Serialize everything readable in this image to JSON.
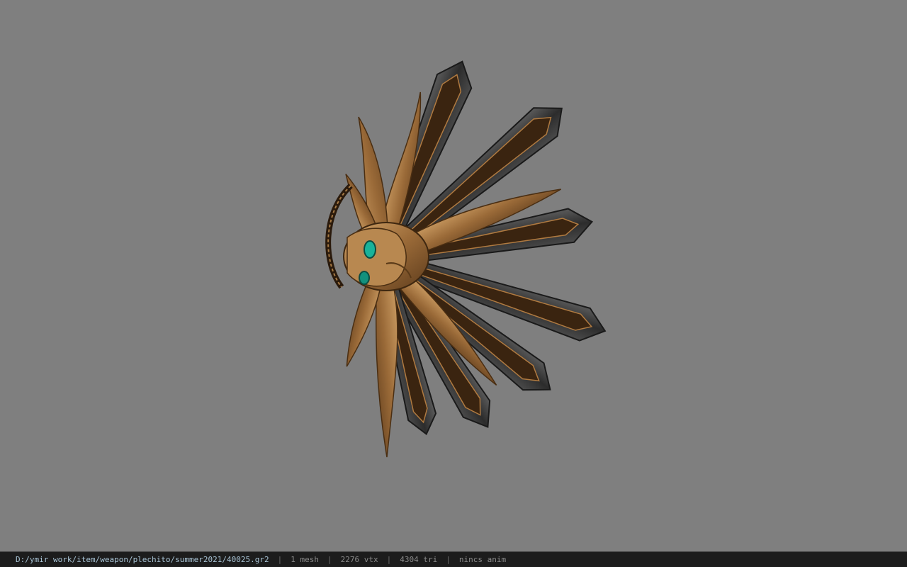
{
  "viewer": {
    "background_color": "#7f7f7f",
    "model": {
      "icon": "fan-blade-weapon-model",
      "colors": {
        "bronze": "#9a6a38",
        "bronze_light": "#c79a5e",
        "blade_dark": "#2a2a2a",
        "blade_edge": "#5a5a5a",
        "gem": "#18b39a"
      }
    }
  },
  "status_bar": {
    "file_path": "D:/ymir work/item/weapon/plechito/summer2021/40025.gr2",
    "separator": "|",
    "mesh_count": "1 mesh",
    "vertex_count": "2276 vtx",
    "triangle_count": "4304 tri",
    "anim_status": "nincs anim"
  }
}
